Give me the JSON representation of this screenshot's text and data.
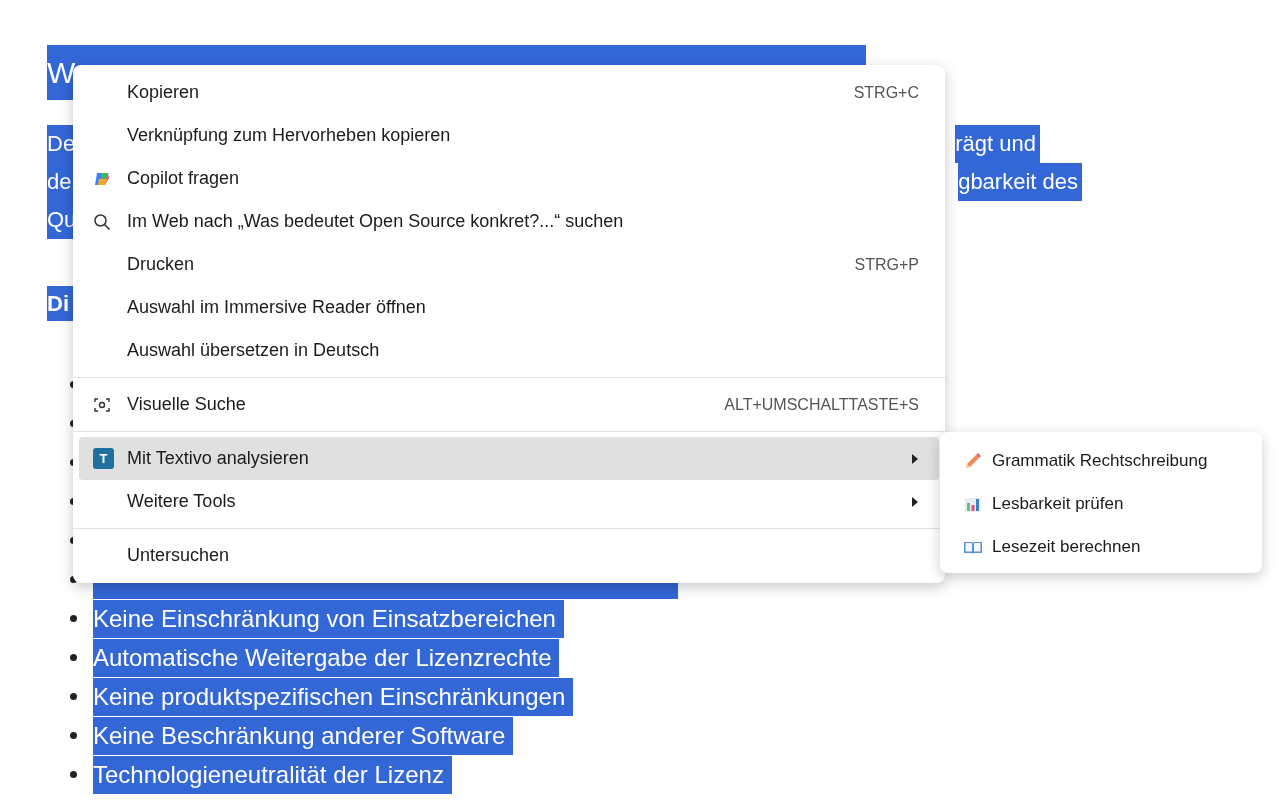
{
  "page": {
    "heading": "W",
    "paragraph_lines": [
      {
        "start": "De",
        "end": "rägt und"
      },
      {
        "start": "de",
        "end": "gbarkeit des"
      },
      {
        "start": "Qu"
      }
    ],
    "subheading": "Di",
    "list_items": [
      {
        "kind": "covered"
      },
      {
        "kind": "covered"
      },
      {
        "kind": "covered"
      },
      {
        "kind": "covered"
      },
      {
        "kind": "covered"
      },
      {
        "kind": "highlighted"
      },
      {
        "kind": "text",
        "text": "Keine Einschränkung von Einsatzbereichen"
      },
      {
        "kind": "text",
        "text": "Automatische Weitergabe der Lizenzrechte"
      },
      {
        "kind": "text",
        "text": "Keine produktspezifischen Einschränkungen"
      },
      {
        "kind": "text",
        "text": "Keine Beschränkung anderer Software"
      },
      {
        "kind": "text",
        "text": "Technologieneutralität der Lizenz"
      }
    ]
  },
  "context_menu": {
    "items": [
      {
        "kind": "plain",
        "label": "Kopieren",
        "shortcut": "STRG+C",
        "selected": false
      },
      {
        "kind": "plain",
        "label": "Verknüpfung zum Hervorheben kopieren",
        "selected": false
      },
      {
        "kind": "copilot",
        "label": "Copilot fragen",
        "selected": false
      },
      {
        "kind": "search",
        "label": "Im Web nach „Was bedeutet Open Source konkret?...“ suchen",
        "selected": false
      },
      {
        "kind": "plain",
        "label": "Drucken",
        "shortcut": "STRG+P",
        "selected": false
      },
      {
        "kind": "plain",
        "label": "Auswahl im Immersive Reader öffnen",
        "selected": false
      },
      {
        "kind": "plain",
        "label": "Auswahl übersetzen in Deutsch",
        "selected": false
      },
      {
        "kind": "separator"
      },
      {
        "kind": "lens",
        "label": "Visuelle Suche",
        "shortcut": "ALT+UMSCHALTTASTE+S",
        "selected": false
      },
      {
        "kind": "separator"
      },
      {
        "kind": "app",
        "label": "Mit Textivo analysieren",
        "icon_text": "T",
        "submenu": true,
        "selected": true
      },
      {
        "kind": "plain",
        "label": "Weitere Tools",
        "submenu": true,
        "selected": false
      },
      {
        "kind": "separator"
      },
      {
        "kind": "plain",
        "label": "Untersuchen",
        "selected": false
      }
    ]
  },
  "submenu": {
    "items": [
      {
        "kind": "pencil",
        "label": "Grammatik  Rechtschreibung",
        "selected": false
      },
      {
        "kind": "chart",
        "label": "Lesbarkeit prüfen",
        "selected": false
      },
      {
        "kind": "book",
        "label": "Lesezeit berechnen",
        "selected": false
      }
    ]
  }
}
